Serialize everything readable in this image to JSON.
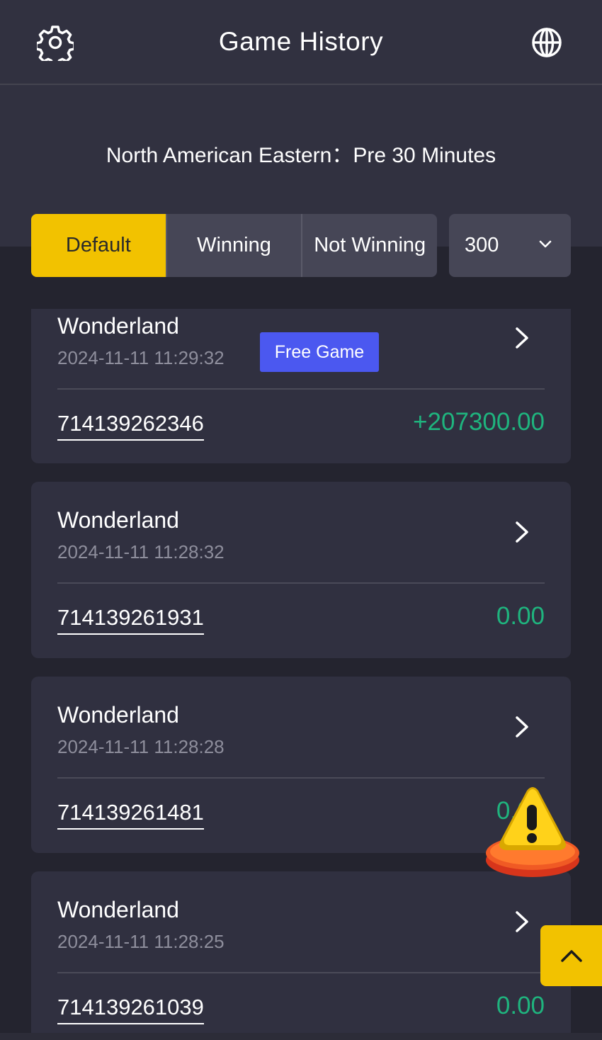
{
  "header": {
    "title": "Game History",
    "settings_icon": "gear-icon",
    "language_icon": "globe-icon"
  },
  "timezone_text": "North American Eastern：Pre 30 Minutes",
  "filters": {
    "tabs": [
      {
        "label": "Default",
        "active": true
      },
      {
        "label": "Winning",
        "active": false
      },
      {
        "label": "Not Winning",
        "active": false
      }
    ],
    "count_select": {
      "value": "300",
      "icon": "chevron-down-icon"
    }
  },
  "records": [
    {
      "game": "Wonderland",
      "time": "2024-11-11 11:29:32",
      "badge": "Free Game",
      "order_id": "714139262346",
      "amount": "+207300.00"
    },
    {
      "game": "Wonderland",
      "time": "2024-11-11 11:28:32",
      "order_id": "714139261931",
      "amount": "0.00"
    },
    {
      "game": "Wonderland",
      "time": "2024-11-11 11:28:28",
      "order_id": "714139261481",
      "amount": "0.00"
    },
    {
      "game": "Wonderland",
      "time": "2024-11-11 11:28:25",
      "order_id": "714139261039",
      "amount": "0.00"
    }
  ],
  "floating": {
    "warning_icon": "warning-icon",
    "back_to_top_icon": "chevron-up-icon"
  },
  "colors": {
    "background": "#24242f",
    "header_background": "#313140",
    "card_background": "#303040",
    "accent_yellow": "#f2c200",
    "badge_blue": "#4b58f0",
    "amount_green": "#1fb47e"
  }
}
